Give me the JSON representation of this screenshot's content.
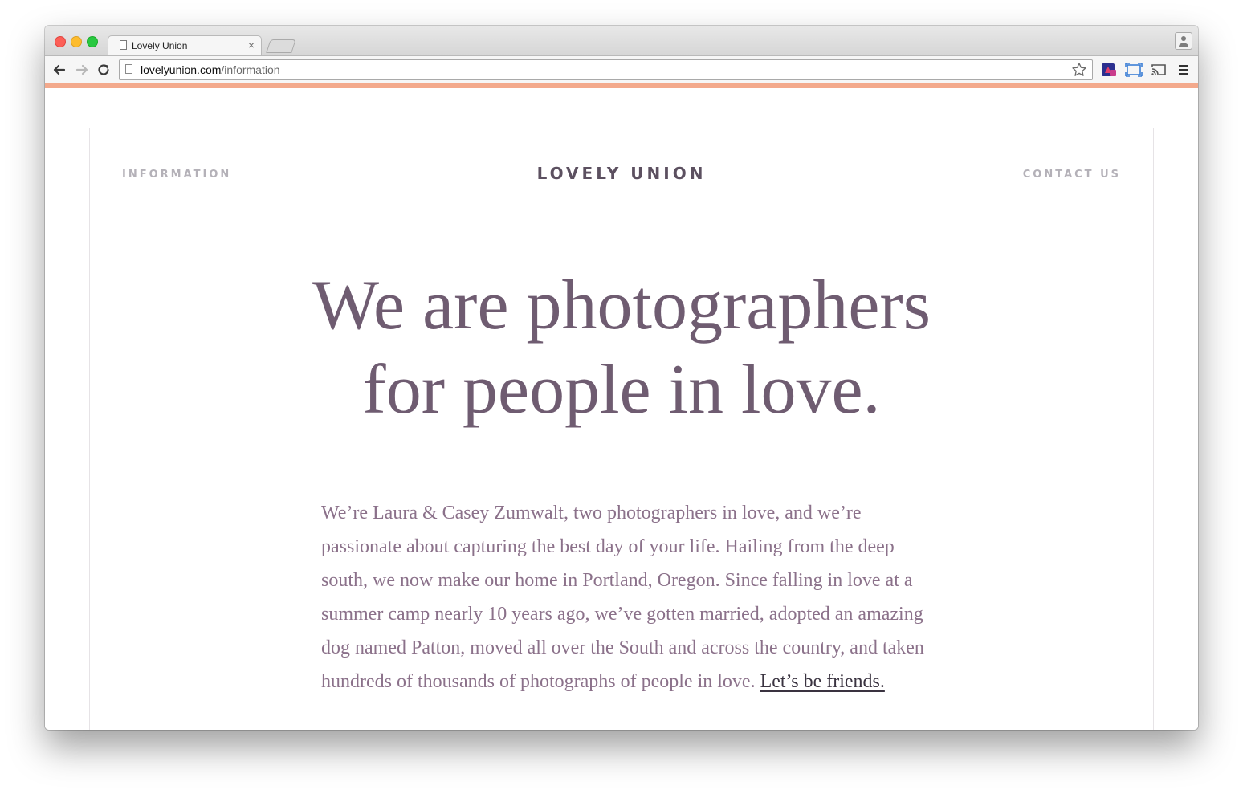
{
  "browser": {
    "tab_title": "Lovely Union",
    "tab_close": "×",
    "url_host": "lovelyunion.com",
    "url_path": "/information",
    "accent_color": "#f3a98c"
  },
  "site": {
    "nav_left": "INFORMATION",
    "brand": "LOVELY UNION",
    "nav_right": "CONTACT US",
    "headline_line1": "We are photographers",
    "headline_line2": "for people in love.",
    "intro_text": "We’re Laura & Casey Zumwalt, two photographers in love, and we’re passionate about capturing the best day of your life. Hailing from the deep south, we now make our home in Portland, Oregon. Since falling in love at a summer camp nearly 10 years ago, we’ve gotten married, adopted an amazing dog named Patton, moved all over the South and across the country, and taken hundreds of thousands of photographs of people in love. ",
    "intro_link": "Let’s be friends.",
    "colors": {
      "headline": "#6f5c71",
      "body": "#8b718a",
      "nav": "#b4b1b8",
      "brand": "#5c5060"
    }
  }
}
